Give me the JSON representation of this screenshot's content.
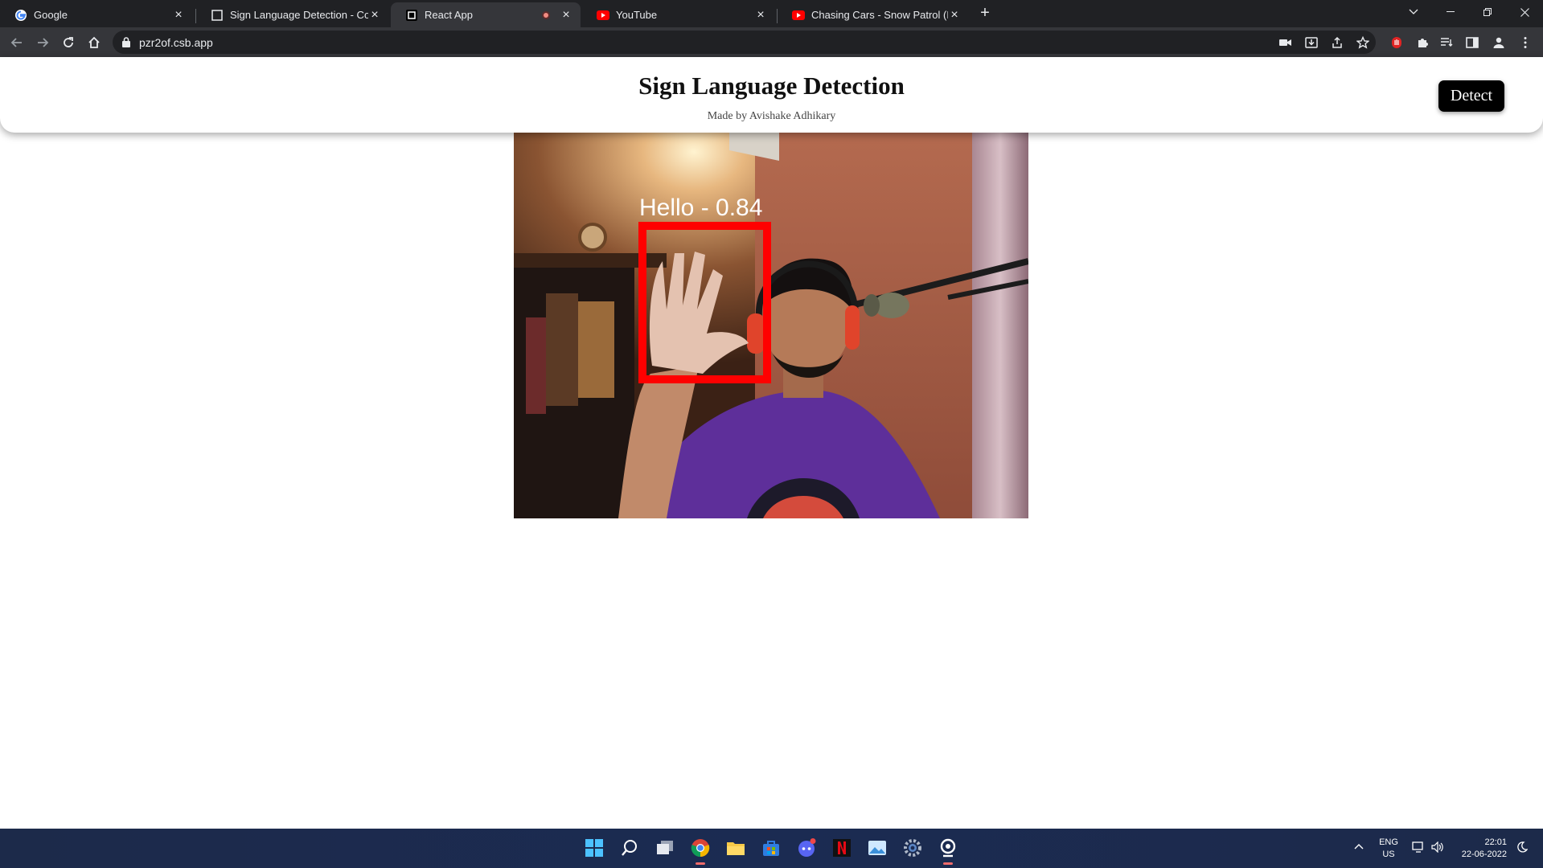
{
  "browser": {
    "tabs": [
      {
        "title": "Google",
        "icon": "google-icon",
        "active": false
      },
      {
        "title": "Sign Language Detection - Code",
        "icon": "codesandbox-icon",
        "active": false
      },
      {
        "title": "React App",
        "icon": "codesandbox-icon",
        "active": true,
        "recording": true
      },
      {
        "title": "YouTube",
        "icon": "youtube-icon",
        "active": false
      },
      {
        "title": "Chasing Cars - Snow Patrol (Boyc",
        "icon": "youtube-icon",
        "active": false
      }
    ],
    "url": "pzr2of.csb.app"
  },
  "page": {
    "title": "Sign Language Detection",
    "subtitle": "Made by Avishake Adhikary",
    "detect_button": "Detect"
  },
  "detection": {
    "label": "Hello",
    "score": 0.84,
    "display": "Hello - 0.84",
    "box_color": "#ff0000"
  },
  "taskbar": {
    "apps": [
      "windows-start-icon",
      "search-icon",
      "task-view-icon",
      "chrome-icon",
      "file-explorer-icon",
      "store-icon",
      "discord-icon",
      "netflix-icon",
      "photos-icon",
      "settings-icon",
      "camera-icon"
    ],
    "language": "ENG",
    "region": "US",
    "time": "22:01",
    "date": "22-06-2022"
  }
}
